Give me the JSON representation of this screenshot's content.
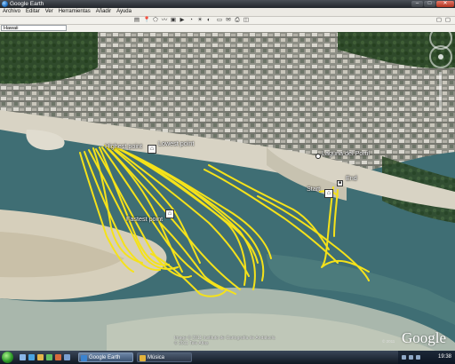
{
  "window": {
    "title": "Google Earth",
    "controls": [
      "–",
      "□",
      "✕"
    ]
  },
  "menu": {
    "items": [
      "Archivo",
      "Editar",
      "Ver",
      "Herramientas",
      "Añadir",
      "Ayuda"
    ]
  },
  "search": {
    "value": "Hawaii"
  },
  "map": {
    "labels": {
      "highest": "Highest point",
      "lowest": "Lowest point",
      "fastest": "Fastest point",
      "start": "Start",
      "end": "End",
      "place": "Laguna del Portil"
    },
    "attribution": "Image © 2011 Instituto de Cartografía de Andalucía\n© 2011 Tele Atlas",
    "brand": "Google",
    "status_small": "© 2011"
  },
  "colors": {
    "track": "#f5e21a",
    "water": "#3f6e74",
    "sand": "#cfc7b3"
  },
  "taskbar": {
    "tasks": [
      {
        "label": "Google Earth",
        "active": true
      },
      {
        "label": "Música",
        "active": false
      }
    ],
    "clock": "19:38"
  }
}
